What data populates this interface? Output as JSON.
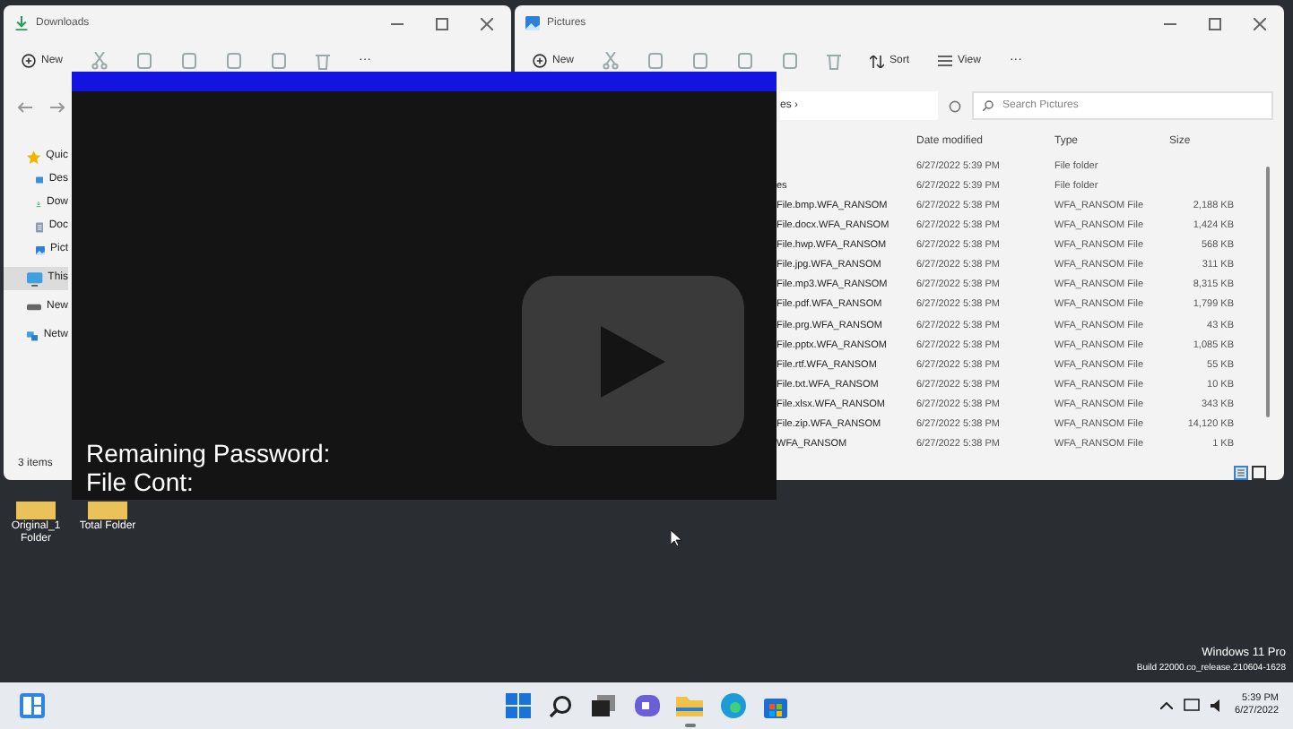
{
  "downloads_window": {
    "title": "Downloads",
    "toolbar": {
      "new": "New",
      "more": "···"
    },
    "sidebar": [
      {
        "label": "Quic",
        "kind": "star",
        "selected": false,
        "children": [
          {
            "label": "Des",
            "kind": "desktop",
            "selected": false
          },
          {
            "label": "Dow",
            "kind": "download",
            "selected": false
          },
          {
            "label": "Doc",
            "kind": "documents",
            "selected": false
          },
          {
            "label": "Pict",
            "kind": "pictures",
            "selected": false
          }
        ]
      },
      {
        "label": "This",
        "kind": "pc",
        "selected": true
      },
      {
        "label": "New",
        "kind": "drive",
        "selected": false
      },
      {
        "label": "Netw",
        "kind": "network",
        "selected": false
      }
    ],
    "status": "3 items"
  },
  "pictures_window": {
    "title": "Pictures",
    "toolbar": {
      "new": "New",
      "sort": "Sort",
      "view": "View",
      "more": "···"
    },
    "address": "es ›",
    "search": {
      "placeholder": "Search Pictures"
    },
    "columns": [
      "Date modified",
      "Type",
      "Size"
    ],
    "rows": [
      {
        "name": "",
        "date": "6/27/2022 5:39 PM",
        "type": "File folder",
        "size": ""
      },
      {
        "name": "es",
        "date": "6/27/2022 5:39 PM",
        "type": "File folder",
        "size": ""
      },
      {
        "name": "File.bmp.WFA_RANSOM",
        "date": "6/27/2022 5:38 PM",
        "type": "WFA_RANSOM File",
        "size": "2,188 KB"
      },
      {
        "name": "File.docx.WFA_RANSOM",
        "date": "6/27/2022 5:38 PM",
        "type": "WFA_RANSOM File",
        "size": "1,424 KB"
      },
      {
        "name": "File.hwp.WFA_RANSOM",
        "date": "6/27/2022 5:38 PM",
        "type": "WFA_RANSOM File",
        "size": "568 KB"
      },
      {
        "name": "File.jpg.WFA_RANSOM",
        "date": "6/27/2022 5:38 PM",
        "type": "WFA_RANSOM File",
        "size": "311 KB"
      },
      {
        "name": "File.mp3.WFA_RANSOM",
        "date": "6/27/2022 5:38 PM",
        "type": "WFA_RANSOM File",
        "size": "8,315 KB"
      },
      {
        "name": "File.pdf.WFA_RANSOM",
        "date": "6/27/2022 5:38 PM",
        "type": "WFA_RANSOM File",
        "size": "1,799 KB"
      },
      {
        "name": "File.prg.WFA_RANSOM",
        "date": "6/27/2022 5:38 PM",
        "type": "WFA_RANSOM File",
        "size": "43 KB"
      },
      {
        "name": "File.pptx.WFA_RANSOM",
        "date": "6/27/2022 5:38 PM",
        "type": "WFA_RANSOM File",
        "size": "1,085 KB"
      },
      {
        "name": "File.rtf.WFA_RANSOM",
        "date": "6/27/2022 5:38 PM",
        "type": "WFA_RANSOM File",
        "size": "55 KB"
      },
      {
        "name": "File.txt.WFA_RANSOM",
        "date": "6/27/2022 5:38 PM",
        "type": "WFA_RANSOM File",
        "size": "10 KB"
      },
      {
        "name": "File.xlsx.WFA_RANSOM",
        "date": "6/27/2022 5:38 PM",
        "type": "WFA_RANSOM File",
        "size": "343 KB"
      },
      {
        "name": "File.zip.WFA_RANSOM",
        "date": "6/27/2022 5:38 PM",
        "type": "WFA_RANSOM File",
        "size": "14,120 KB"
      },
      {
        "name": "WFA_RANSOM",
        "date": "6/27/2022 5:38 PM",
        "type": "WFA_RANSOM File",
        "size": "1 KB"
      }
    ],
    "view_buttons": [
      {
        "kind": "details",
        "selected": true
      },
      {
        "kind": "tiles",
        "selected": false
      }
    ]
  },
  "video": {
    "lines": [
      "Remaining Password:",
      "File Cont:"
    ]
  },
  "desktop_icons": [
    {
      "label": "Original_1 Folder"
    },
    {
      "label": "Total Folder"
    }
  ],
  "os_info": [
    "Windows 11 Pro",
    "Build 22000.co_release.210604-1628"
  ],
  "taskbar": {
    "apps": [
      {
        "kind": "widgets",
        "running": false
      },
      {
        "kind": "start",
        "running": false
      },
      {
        "kind": "search",
        "running": false
      },
      {
        "kind": "taskview",
        "running": false
      },
      {
        "kind": "chat",
        "running": false
      },
      {
        "kind": "explorer",
        "running": true
      },
      {
        "kind": "edge",
        "running": false
      },
      {
        "kind": "store",
        "running": false
      }
    ],
    "time": "5:39 PM",
    "date": "6/27/2022"
  }
}
